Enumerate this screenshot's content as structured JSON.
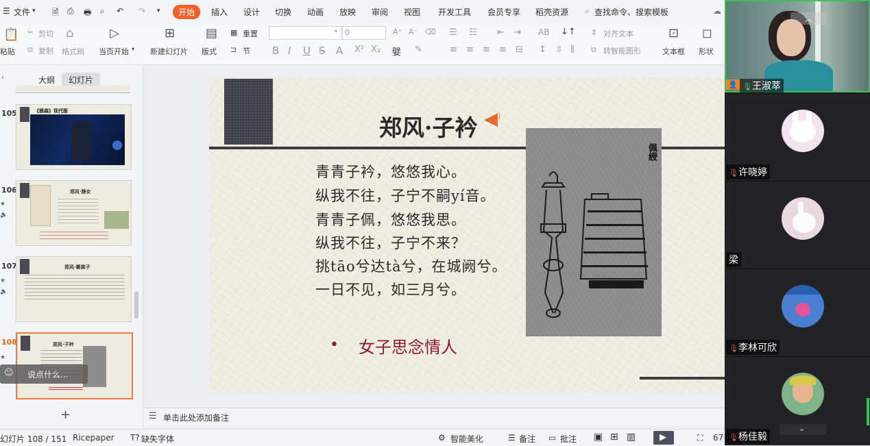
{
  "menu": {
    "file": "文件",
    "items": [
      "开始",
      "插入",
      "设计",
      "切换",
      "动画",
      "放映",
      "审阅",
      "视图",
      "开发工具",
      "会员专享",
      "稻壳资源"
    ],
    "active_index": 0,
    "search_placeholder": "查找命令、搜索模板"
  },
  "toolbar": {
    "paste": "粘贴",
    "cut": "剪切",
    "copy": "复制",
    "format_painter": "格式刷",
    "play_from_current": "当页开始",
    "new_slide": "新建幻灯片",
    "layout": "版式",
    "reset": "重置",
    "section": "节",
    "font_size": "0",
    "align_text": "对齐文本",
    "smart_art": "转智能图形",
    "text_box": "文本框",
    "shape": "形状"
  },
  "left_panel": {
    "tab_outline": "大纲",
    "tab_slides": "幻灯片",
    "thumbnails": [
      {
        "num": "105",
        "title": "《雅森》现代版"
      },
      {
        "num": "106",
        "title": "郑风·静女"
      },
      {
        "num": "107",
        "title": "郑风·褰裳子"
      },
      {
        "num": "108",
        "title": "郑风·子衿"
      }
    ],
    "selected": "108",
    "comment_placeholder": "说点什么...",
    "add_icon": "+"
  },
  "slide": {
    "title": "郑风·子衿",
    "poem_lines": [
      "青青子衿，悠悠我心。",
      "纵我不往，子宁不嗣yí音。",
      "青青子佩，悠悠我思。",
      "纵我不往，子宁不来？",
      "挑tāo兮达tà兮，在城阙兮。",
      "一日不见，如三月兮。"
    ],
    "image_caption": "佩綬",
    "bullet": "•",
    "bullet_text": "女子思念情人"
  },
  "notes": {
    "placeholder": "单击此处添加备注"
  },
  "status": {
    "slide_count": "幻灯片 108 / 151",
    "theme": "Ricepaper",
    "missing_font": "缺失字体",
    "smart_beautify": "智能美化",
    "notes": "备注",
    "comments": "批注",
    "zoom": "67"
  },
  "participants": [
    {
      "name": "王淑萃",
      "mic": "on"
    },
    {
      "name": "许晓婷",
      "mic": "muted"
    },
    {
      "name": "梁",
      "mic": "none"
    },
    {
      "name": "李林可欣",
      "mic": "muted"
    },
    {
      "name": "杨佳毅",
      "mic": "muted"
    }
  ],
  "colors": {
    "accent": "#f0622c",
    "slide_bg": "#efeee2",
    "bullet_red": "#8b1a2b",
    "dark_panel": "#1c1c1e"
  }
}
